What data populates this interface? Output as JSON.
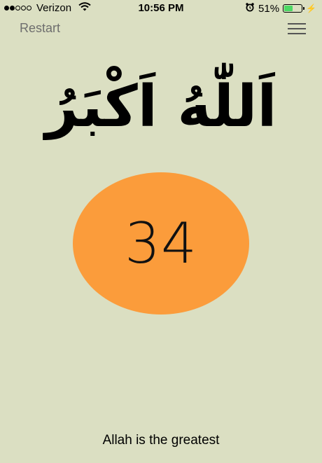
{
  "status_bar": {
    "carrier": "Verizon",
    "time": "10:56 PM",
    "battery_percent": "51%",
    "battery_level": 0.51,
    "signal_bars_filled": 2,
    "signal_bars_total": 5,
    "icons": [
      "wifi-icon",
      "alarm-icon",
      "battery-icon",
      "charging-bolt-icon"
    ]
  },
  "nav": {
    "restart_label": "Restart",
    "menu_icon": "hamburger-menu-icon"
  },
  "dhikr": {
    "arabic": "اَللّٰهُ اَكْبَرُ",
    "count": "34",
    "translation": "Allah is the greatest"
  },
  "colors": {
    "background": "#dbdfc2",
    "counter_circle": "#fb9c3b",
    "battery_fill": "#4cd964"
  }
}
